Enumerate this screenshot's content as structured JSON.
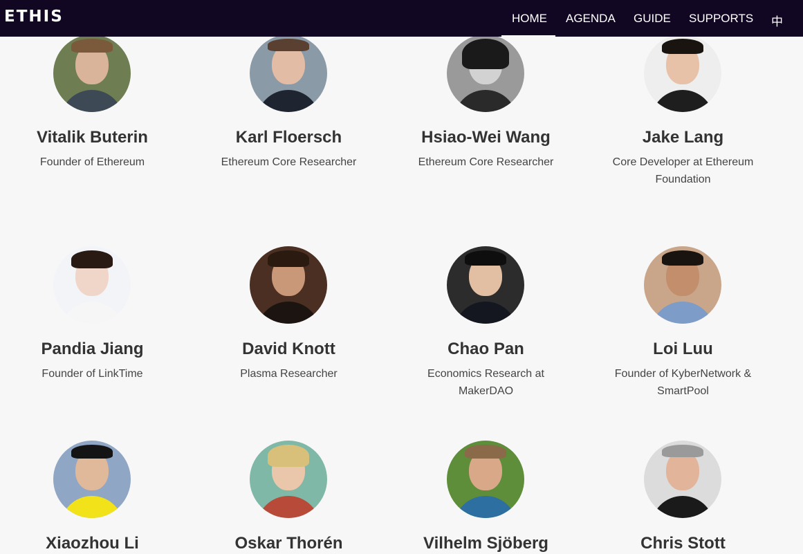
{
  "nav": {
    "brand": "ETHIS",
    "links": [
      "HOME",
      "AGENDA",
      "GUIDE",
      "SUPPORTS",
      "中"
    ]
  },
  "speakers": [
    {
      "name": "Vitalik Buterin",
      "role": "Founder of Ethereum"
    },
    {
      "name": "Karl Floersch",
      "role": "Ethereum Core Researcher"
    },
    {
      "name": "Hsiao-Wei Wang",
      "role": "Ethereum Core Researcher"
    },
    {
      "name": "Jake Lang",
      "role": "Core Developer at Ethereum Foundation"
    },
    {
      "name": "Pandia Jiang",
      "role": "Founder of LinkTime"
    },
    {
      "name": "David Knott",
      "role": "Plasma Researcher"
    },
    {
      "name": "Chao Pan",
      "role": "Economics Research at MakerDAO"
    },
    {
      "name": "Loi Luu",
      "role": "Founder of KyberNetwork & SmartPool"
    },
    {
      "name": "Xiaozhou Li",
      "role": ""
    },
    {
      "name": "Oskar Thorén",
      "role": ""
    },
    {
      "name": "Vilhelm Sjöberg",
      "role": ""
    },
    {
      "name": "Chris Stott",
      "role": ""
    }
  ]
}
